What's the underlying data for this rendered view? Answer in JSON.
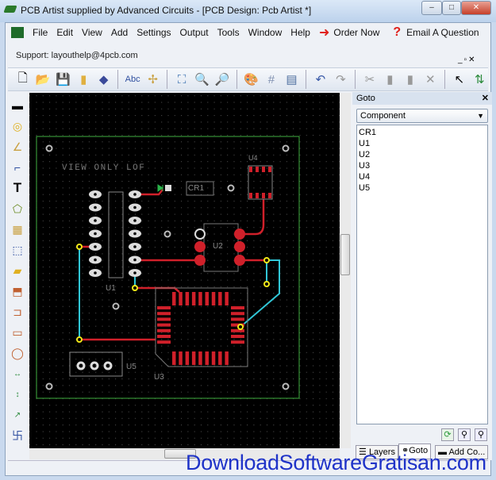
{
  "window": {
    "title": "PCB Artist supplied by Advanced Circuits - [PCB Design: Pcb Artist *]"
  },
  "menu": {
    "items": [
      "File",
      "Edit",
      "View",
      "Add",
      "Settings",
      "Output",
      "Tools",
      "Window",
      "Help"
    ],
    "order_now": "Order Now",
    "email": "Email A Question"
  },
  "support": "Support: layouthelp@4pcb.com",
  "board": {
    "text": "VIEW ONLY LOF",
    "labels": {
      "u1": "U1",
      "u2": "U2",
      "u3": "U3",
      "u4": "U4",
      "u5": "U5",
      "cr1": "CR1"
    },
    "colors": {
      "trace_top": "#d0202a",
      "trace_bottom": "#31c6d6",
      "via": "#f2e818",
      "outline": "#3fae3f",
      "silk": "#9a9a9a"
    }
  },
  "goto_panel": {
    "title": "Goto",
    "filter": "Component",
    "items": [
      "CR1",
      "U1",
      "U2",
      "U3",
      "U4",
      "U5"
    ],
    "tabs": [
      "Layers",
      "Goto",
      "Add Co..."
    ]
  },
  "watermark": "DownloadSoftwareGratisan.com"
}
